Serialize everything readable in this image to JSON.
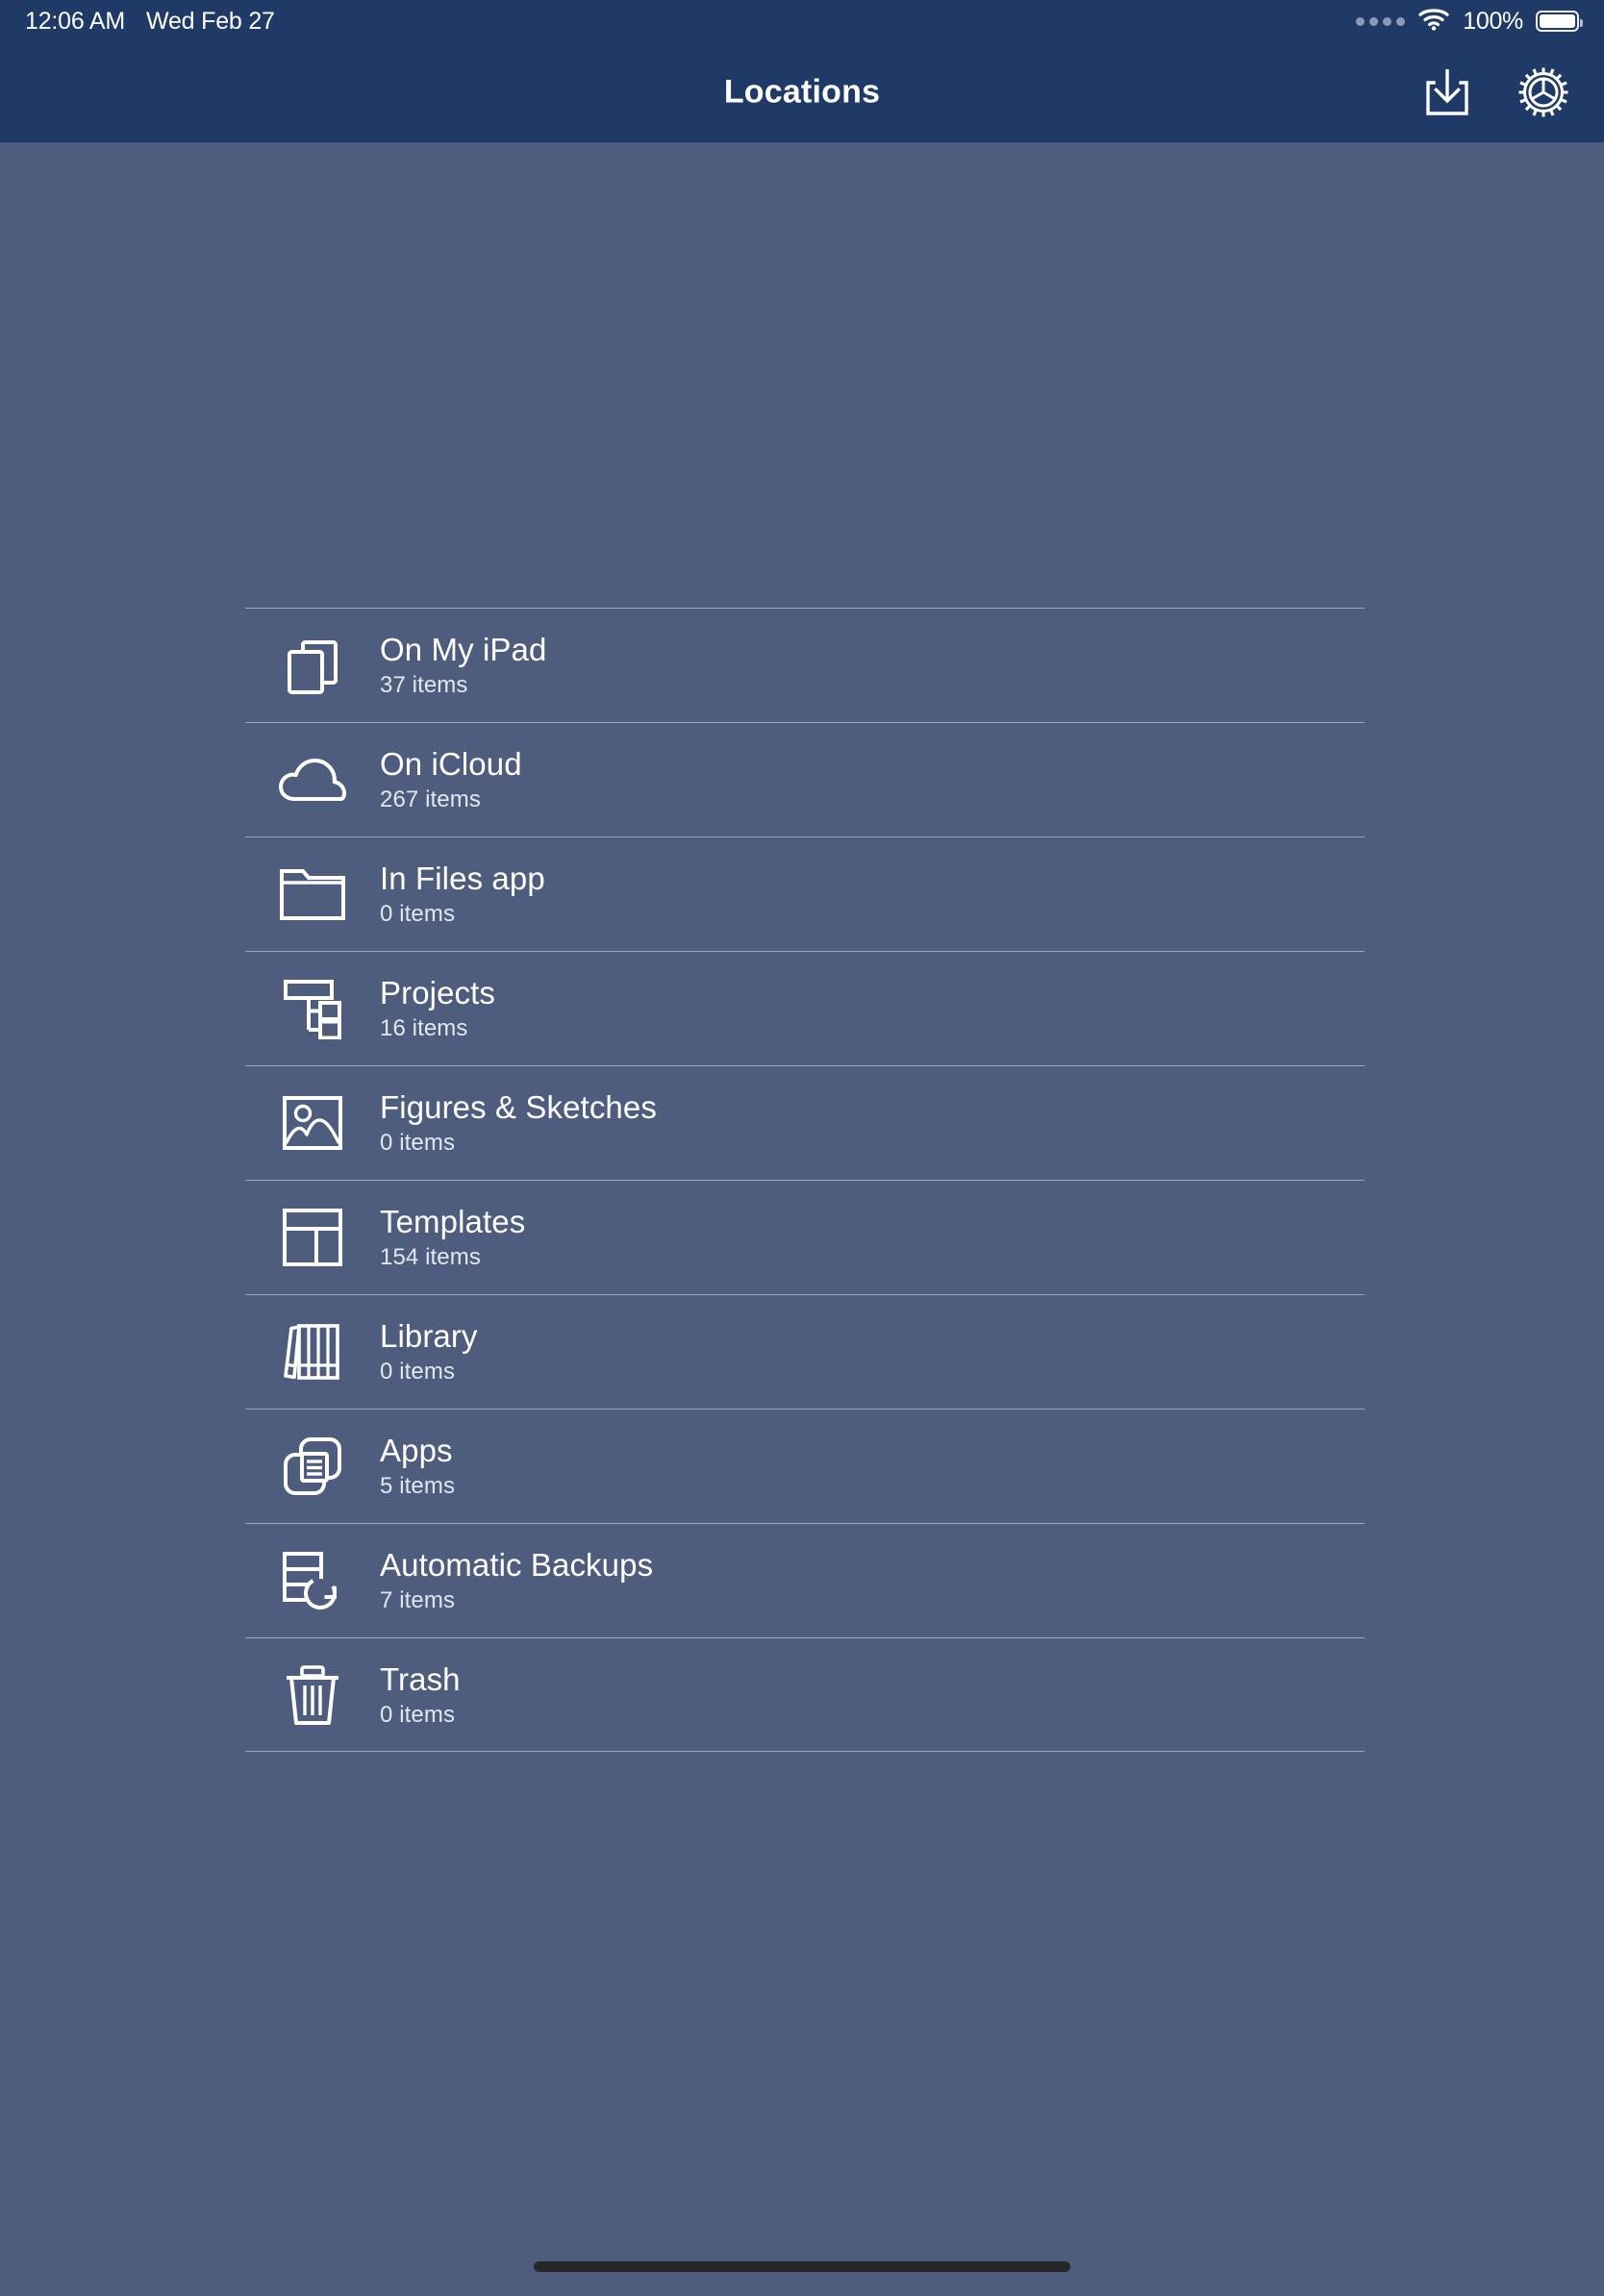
{
  "status_bar": {
    "time": "12:06 AM",
    "date": "Wed Feb 27",
    "battery_percent": "100%",
    "wifi_icon": "wifi-icon",
    "battery_icon": "battery-icon",
    "signal_dots": "signal-dots-icon"
  },
  "nav_bar": {
    "title": "Locations",
    "actions": [
      {
        "name": "import-button",
        "icon": "import-download-icon"
      },
      {
        "name": "settings-button",
        "icon": "gear-icon"
      }
    ],
    "background_color": "#1f3a66"
  },
  "theme": {
    "content_background": "#4e5d7e",
    "separator_color": "rgba(255,255,255,0.45)",
    "text_color": "#ffffff",
    "home_indicator_color": "#262626"
  },
  "locations": [
    {
      "label": "On My iPad",
      "count": "37 items",
      "icon": "documents-stack-icon"
    },
    {
      "label": "On iCloud",
      "count": "267 items",
      "icon": "cloud-icon"
    },
    {
      "label": "In Files app",
      "count": "0 items",
      "icon": "folder-icon"
    },
    {
      "label": "Projects",
      "count": "16 items",
      "icon": "hierarchy-tree-icon"
    },
    {
      "label": "Figures & Sketches",
      "count": "0 items",
      "icon": "image-picture-icon"
    },
    {
      "label": "Templates",
      "count": "154 items",
      "icon": "layout-grid-icon"
    },
    {
      "label": "Library",
      "count": "0 items",
      "icon": "books-shelf-icon"
    },
    {
      "label": "Apps",
      "count": "5 items",
      "icon": "apps-documents-icon"
    },
    {
      "label": "Automatic Backups",
      "count": "7 items",
      "icon": "database-refresh-icon"
    },
    {
      "label": "Trash",
      "count": "0 items",
      "icon": "trash-icon"
    }
  ]
}
